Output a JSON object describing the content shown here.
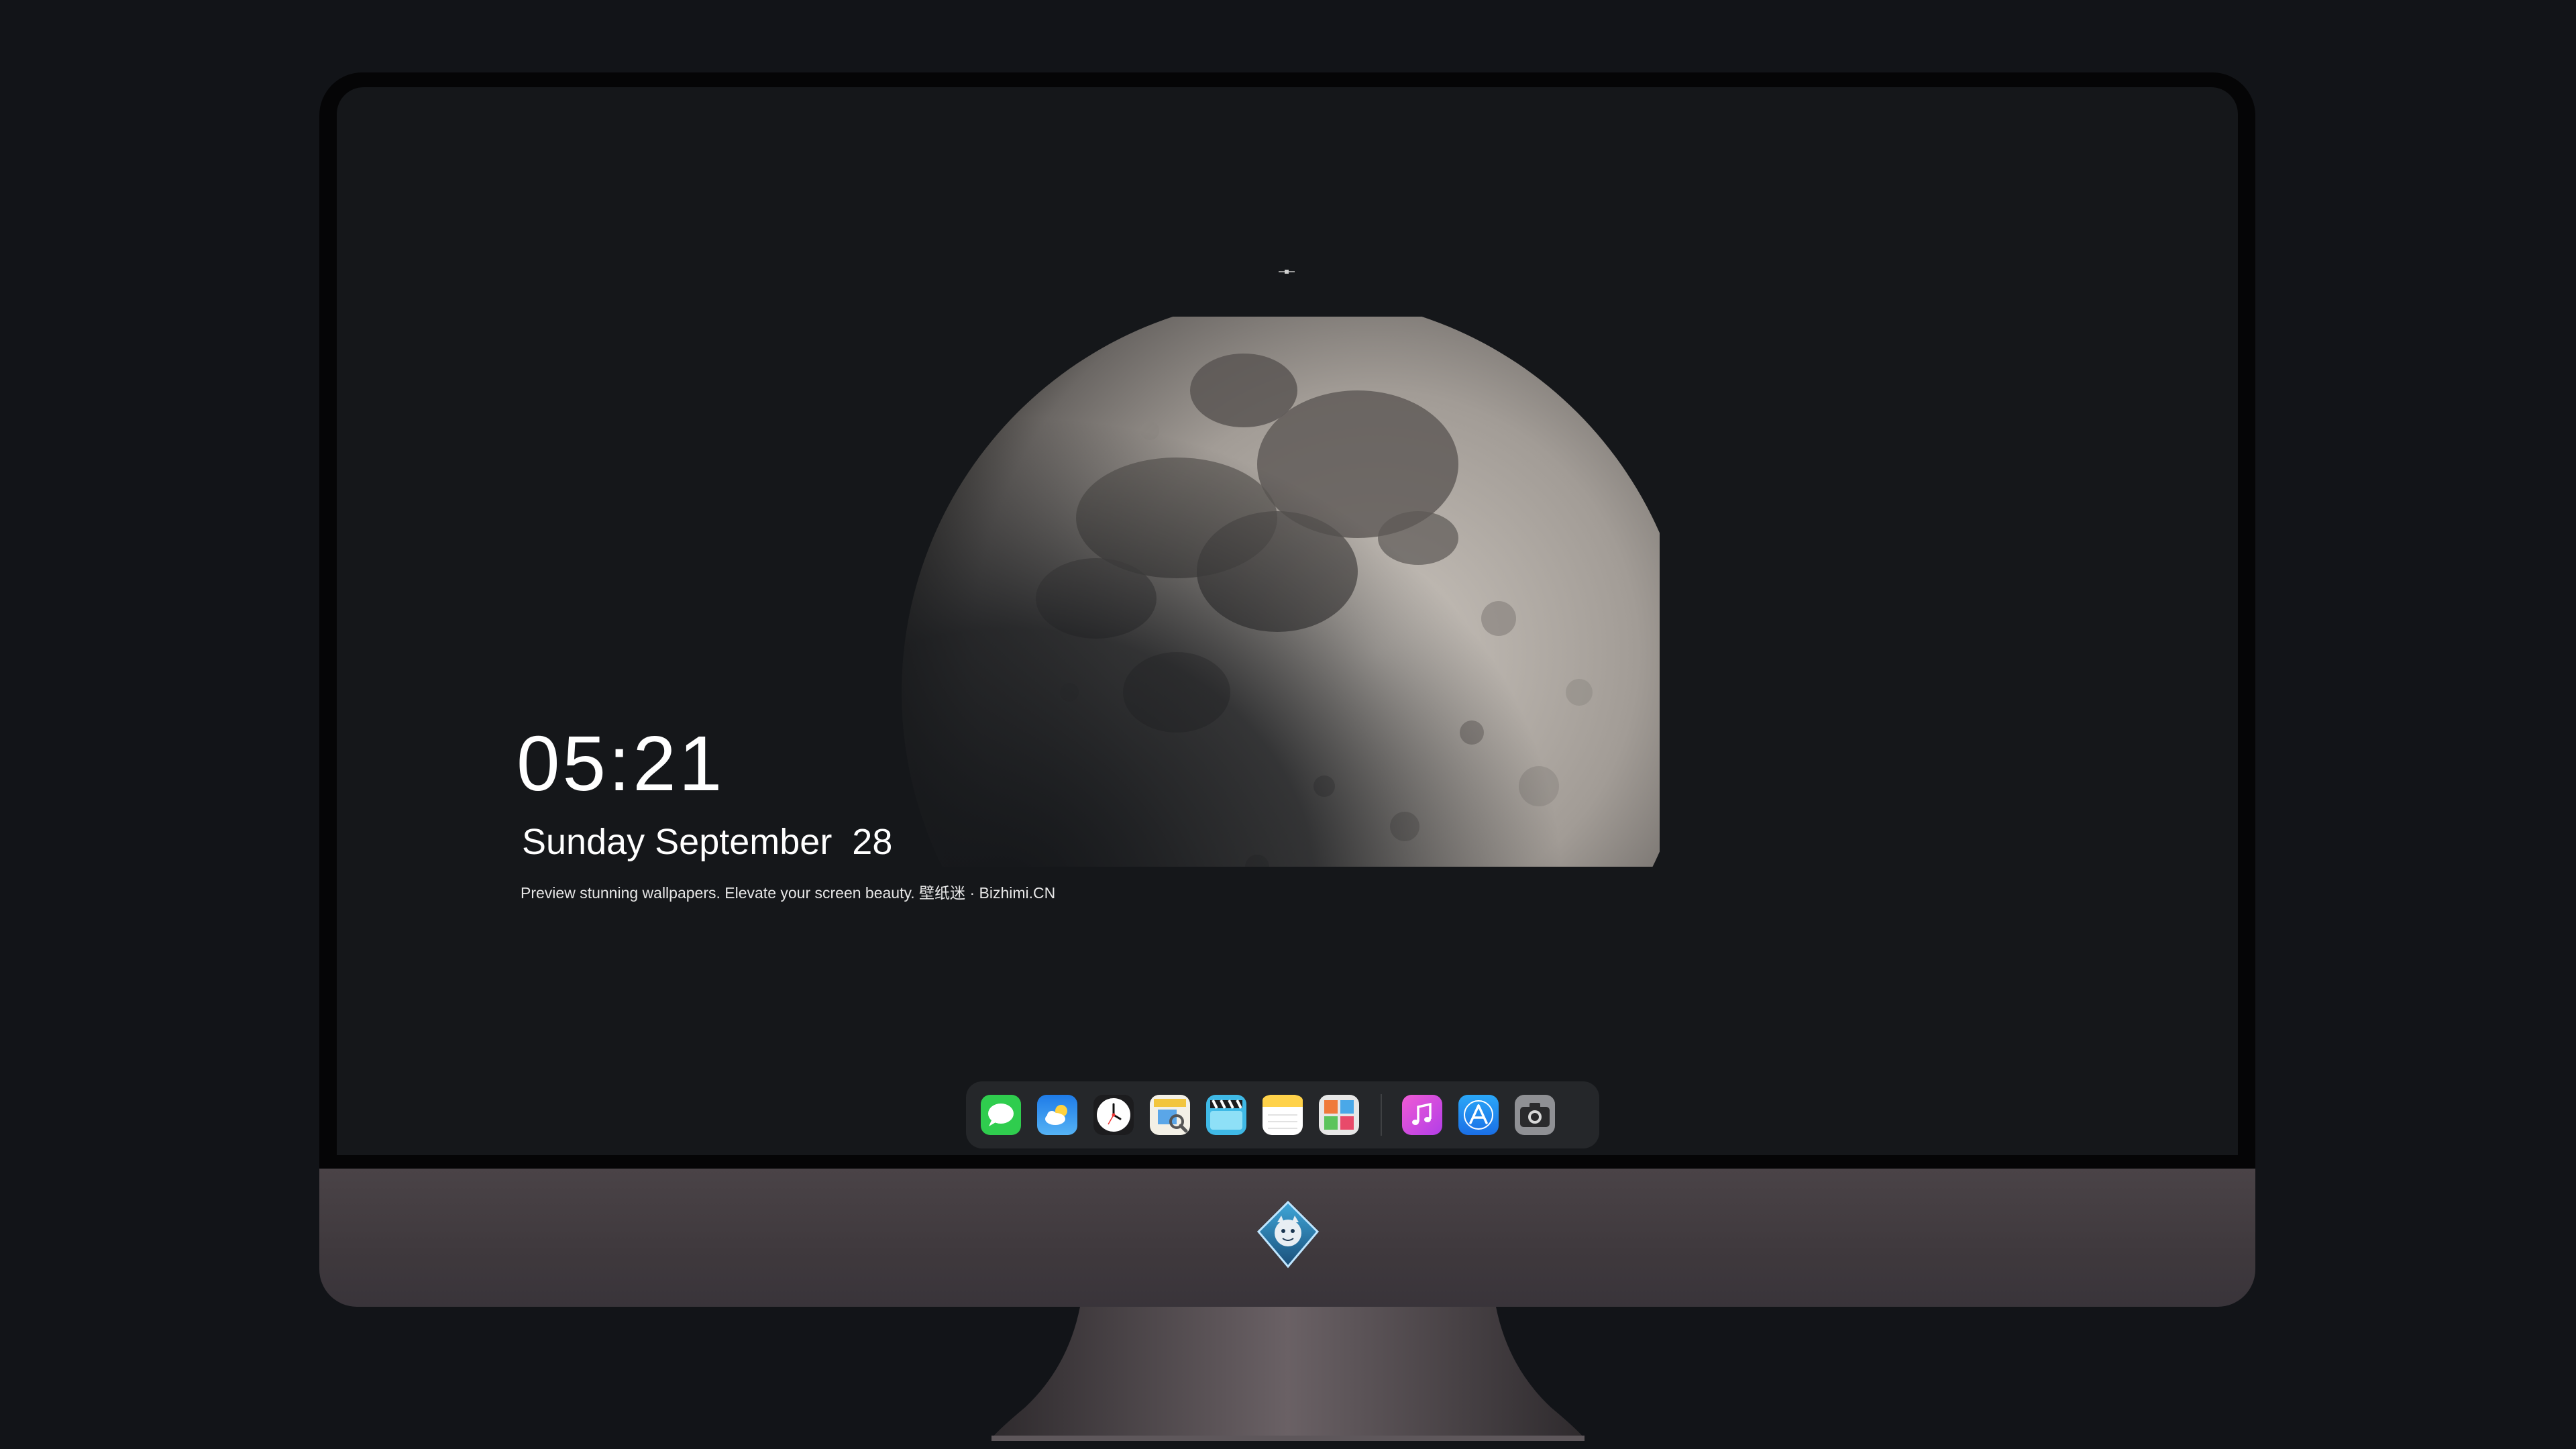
{
  "lockscreen": {
    "time": "05:21",
    "date": "Sunday September  28",
    "tagline": "Preview stunning wallpapers. Elevate your screen beauty. 壁纸迷 · Bizhimi.CN"
  },
  "dock": {
    "apps": [
      {
        "name": "messages-icon",
        "color": "#2fcd4e"
      },
      {
        "name": "weather-icon",
        "color": "#2b8cf0"
      },
      {
        "name": "clock-icon",
        "color": "#ffffff"
      },
      {
        "name": "preview-icon",
        "color": "#f2c53d"
      },
      {
        "name": "clips-icon",
        "color": "#3fb9e6"
      },
      {
        "name": "notes-icon",
        "color": "#ffd24a"
      },
      {
        "name": "photo-booth-icon",
        "color": "#e7e7e7"
      },
      {
        "name": "itunes-icon",
        "color": "#e94bd9"
      },
      {
        "name": "app-store-icon",
        "color": "#1f8ff5"
      },
      {
        "name": "camera-icon",
        "color": "#8f9094"
      }
    ]
  },
  "colors": {
    "background": "#121418",
    "screen": "#15171a",
    "chin": "#433c41"
  }
}
